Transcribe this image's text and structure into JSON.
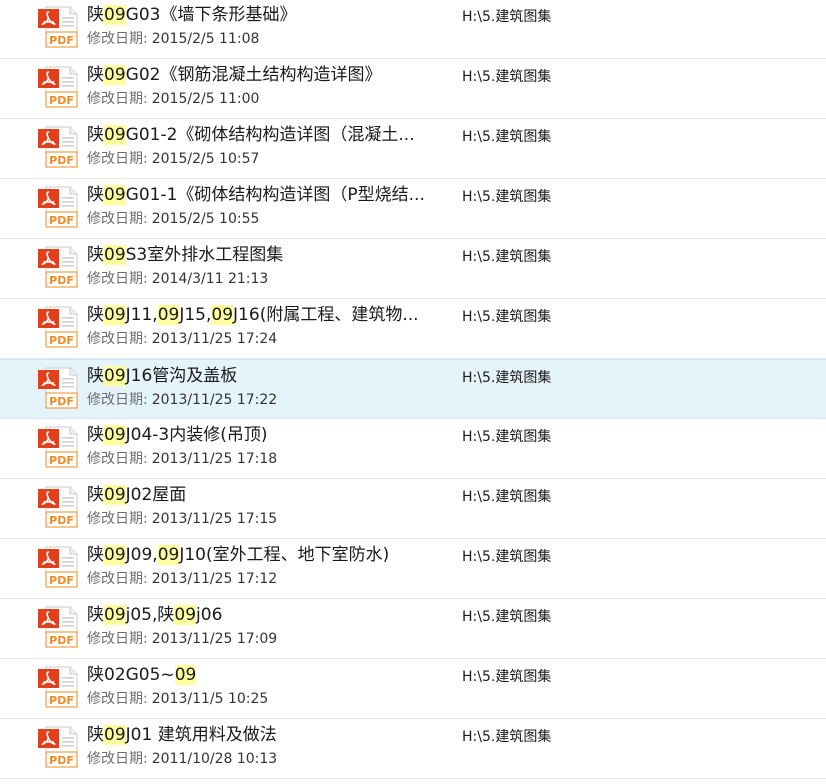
{
  "colors": {
    "highlight": "#ffff9e",
    "selected_row": "#e5f3fb",
    "pdf_red": "#e2401c",
    "pdf_orange": "#f08a24"
  },
  "date_label": "修改日期:",
  "icon": {
    "name": "pdf-file-icon",
    "badge": "PDF"
  },
  "selected_index": 6,
  "items": [
    {
      "name_parts": [
        {
          "t": "陕",
          "h": false
        },
        {
          "t": "09",
          "h": true
        },
        {
          "t": "G03《墙下条形基础》",
          "h": false
        }
      ],
      "date": "2015/2/5 11:08",
      "location": "H:\\5.建筑图集"
    },
    {
      "name_parts": [
        {
          "t": "陕",
          "h": false
        },
        {
          "t": "09",
          "h": true
        },
        {
          "t": "G02《钢筋混凝土结构构造详图》",
          "h": false
        }
      ],
      "date": "2015/2/5 11:00",
      "location": "H:\\5.建筑图集"
    },
    {
      "name_parts": [
        {
          "t": "陕",
          "h": false
        },
        {
          "t": "09",
          "h": true
        },
        {
          "t": "G01-2《砌体结构构造详图（混凝土...",
          "h": false
        }
      ],
      "date": "2015/2/5 10:57",
      "location": "H:\\5.建筑图集"
    },
    {
      "name_parts": [
        {
          "t": "陕",
          "h": false
        },
        {
          "t": "09",
          "h": true
        },
        {
          "t": "G01-1《砌体结构构造详图（P型烧结...",
          "h": false
        }
      ],
      "date": "2015/2/5 10:55",
      "location": "H:\\5.建筑图集"
    },
    {
      "name_parts": [
        {
          "t": "陕",
          "h": false
        },
        {
          "t": "09",
          "h": true
        },
        {
          "t": "S3室外排水工程图集",
          "h": false
        }
      ],
      "date": "2014/3/11 21:13",
      "location": "H:\\5.建筑图集"
    },
    {
      "name_parts": [
        {
          "t": "陕",
          "h": false
        },
        {
          "t": "09",
          "h": true
        },
        {
          "t": "J11,",
          "h": false
        },
        {
          "t": "09",
          "h": true
        },
        {
          "t": "J15,",
          "h": false
        },
        {
          "t": "09",
          "h": true
        },
        {
          "t": "J16(附属工程、建筑物...",
          "h": false
        }
      ],
      "date": "2013/11/25 17:24",
      "location": "H:\\5.建筑图集"
    },
    {
      "name_parts": [
        {
          "t": "陕",
          "h": false
        },
        {
          "t": "09",
          "h": true
        },
        {
          "t": "J16管沟及盖板",
          "h": false
        }
      ],
      "date": "2013/11/25 17:22",
      "location": "H:\\5.建筑图集"
    },
    {
      "name_parts": [
        {
          "t": "陕",
          "h": false
        },
        {
          "t": "09",
          "h": true
        },
        {
          "t": "J04-3内装修(吊顶)",
          "h": false
        }
      ],
      "date": "2013/11/25 17:18",
      "location": "H:\\5.建筑图集"
    },
    {
      "name_parts": [
        {
          "t": "陕",
          "h": false
        },
        {
          "t": "09",
          "h": true
        },
        {
          "t": "J02屋面",
          "h": false
        }
      ],
      "date": "2013/11/25 17:15",
      "location": "H:\\5.建筑图集"
    },
    {
      "name_parts": [
        {
          "t": "陕",
          "h": false
        },
        {
          "t": "09",
          "h": true
        },
        {
          "t": "J09,",
          "h": false
        },
        {
          "t": "09",
          "h": true
        },
        {
          "t": "J10(室外工程、地下室防水)",
          "h": false
        }
      ],
      "date": "2013/11/25 17:12",
      "location": "H:\\5.建筑图集"
    },
    {
      "name_parts": [
        {
          "t": "陕",
          "h": false
        },
        {
          "t": "09",
          "h": true
        },
        {
          "t": "j05,陕",
          "h": false
        },
        {
          "t": "09",
          "h": true
        },
        {
          "t": "j06",
          "h": false
        }
      ],
      "date": "2013/11/25 17:09",
      "location": "H:\\5.建筑图集"
    },
    {
      "name_parts": [
        {
          "t": "陕02G05~",
          "h": false
        },
        {
          "t": "09",
          "h": true
        }
      ],
      "date": "2013/11/5 10:25",
      "location": "H:\\5.建筑图集"
    },
    {
      "name_parts": [
        {
          "t": "陕",
          "h": false
        },
        {
          "t": "09",
          "h": true
        },
        {
          "t": "J01 建筑用料及做法",
          "h": false
        }
      ],
      "date": "2011/10/28 10:13",
      "location": "H:\\5.建筑图集"
    }
  ]
}
